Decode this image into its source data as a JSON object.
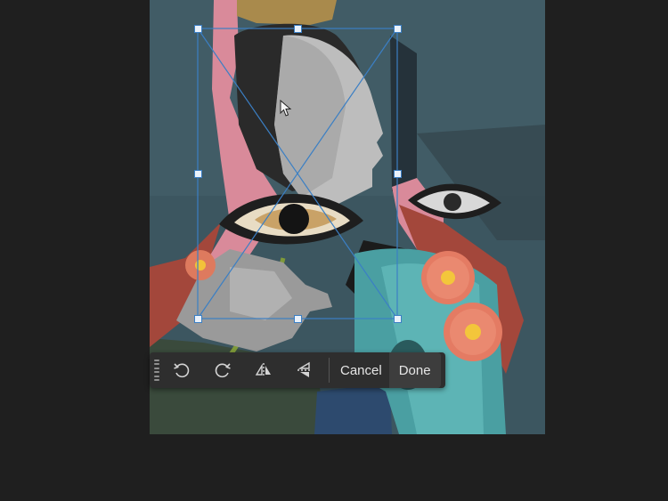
{
  "toolbar": {
    "cancel_label": "Cancel",
    "done_label": "Done",
    "tools": [
      {
        "name": "rotate-left-icon"
      },
      {
        "name": "rotate-right-icon"
      },
      {
        "name": "flip-horizontal-icon"
      },
      {
        "name": "flip-vertical-icon"
      }
    ]
  },
  "colors": {
    "background": "#1f1f1f",
    "canvas_teal": "#3c5660",
    "selection_blue": "#3b7fc4",
    "toolbar": "#2e2e2e",
    "toolbar_text": "#e6e6e6"
  }
}
